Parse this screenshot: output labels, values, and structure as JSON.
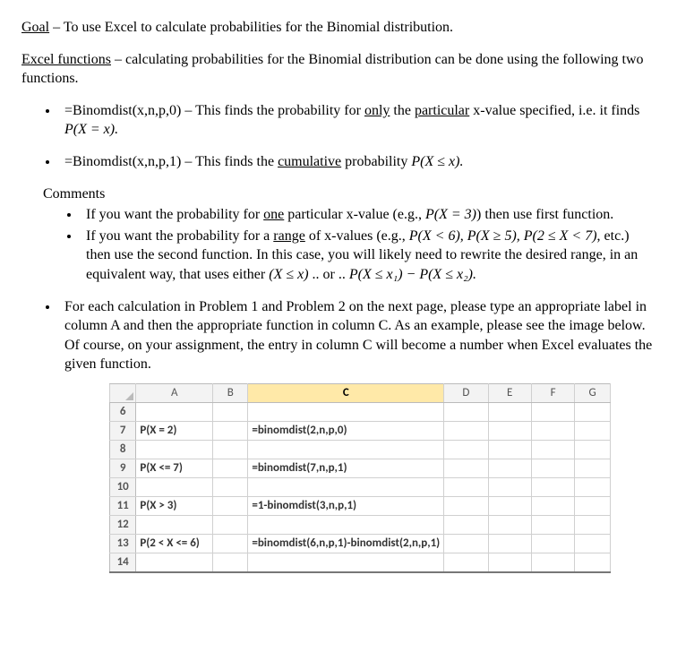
{
  "goal_label": "Goal",
  "goal_text": " – To use Excel to calculate probabilities for the Binomial distribution.",
  "funcs_label": "Excel functions",
  "funcs_text": " – calculating probabilities for the Binomial distribution can be done using the following two functions.",
  "b1_pre": "=Binomdist(x,n,p,0) – This finds the probability for ",
  "b1_u1": "only",
  "b1_mid": " the ",
  "b1_u2": "particular",
  "b1_post": " x-value specified, i.e. it finds ",
  "b1_math": "P(X = x).",
  "b2_pre": "=Binomdist(x,n,p,1) – This finds the ",
  "b2_u": "cumulative",
  "b2_post": " probability ",
  "b2_math": "P(X ≤ x).",
  "comments_label": "Comments",
  "c1_pre": "If you want the probability for ",
  "c1_u": "one",
  "c1_mid": " particular x-value (e.g., ",
  "c1_math": "P(X = 3)",
  "c1_post": ") then use first function.",
  "c2_pre": "If you want the probability for a ",
  "c2_u": "range",
  "c2_mid": " of x-values (e.g., ",
  "c2_math1": "P(X < 6), P(X ≥ 5), P(2 ≤ X < 7)",
  "c2_mid2": ", etc.) then use the second function.  In this case, you will likely need to rewrite the desired range, in an equivalent way, that uses either ",
  "c2_math2": "(X ≤ x)",
  "c2_or": " .. or .. ",
  "c2_math3": "P(X ≤ x₁) − P(X ≤ x₂).",
  "instr": "For each calculation in Problem 1 and Problem 2 on the next page, please type an appropriate label in column A and then the appropriate function in column C.  As an example, please see the image below.  Of course, on your assignment, the entry in column C will become a number when Excel evaluates the given function.",
  "sheet": {
    "cols": [
      "A",
      "B",
      "C",
      "D",
      "E",
      "F",
      "G"
    ],
    "active_col": "C",
    "row_start": 6,
    "row_end": 14,
    "rows": {
      "7": {
        "A": "P(X = 2)",
        "C": "=binomdist(2,n,p,0)"
      },
      "9": {
        "A": "P(X <= 7)",
        "C": "=binomdist(7,n,p,1)"
      },
      "11": {
        "A": "P(X > 3)",
        "C": "=1-binomdist(3,n,p,1)"
      },
      "13": {
        "A": "P(2 < X <= 6)",
        "C": "=binomdist(6,n,p,1)-binomdist(2,n,p,1)"
      }
    }
  }
}
